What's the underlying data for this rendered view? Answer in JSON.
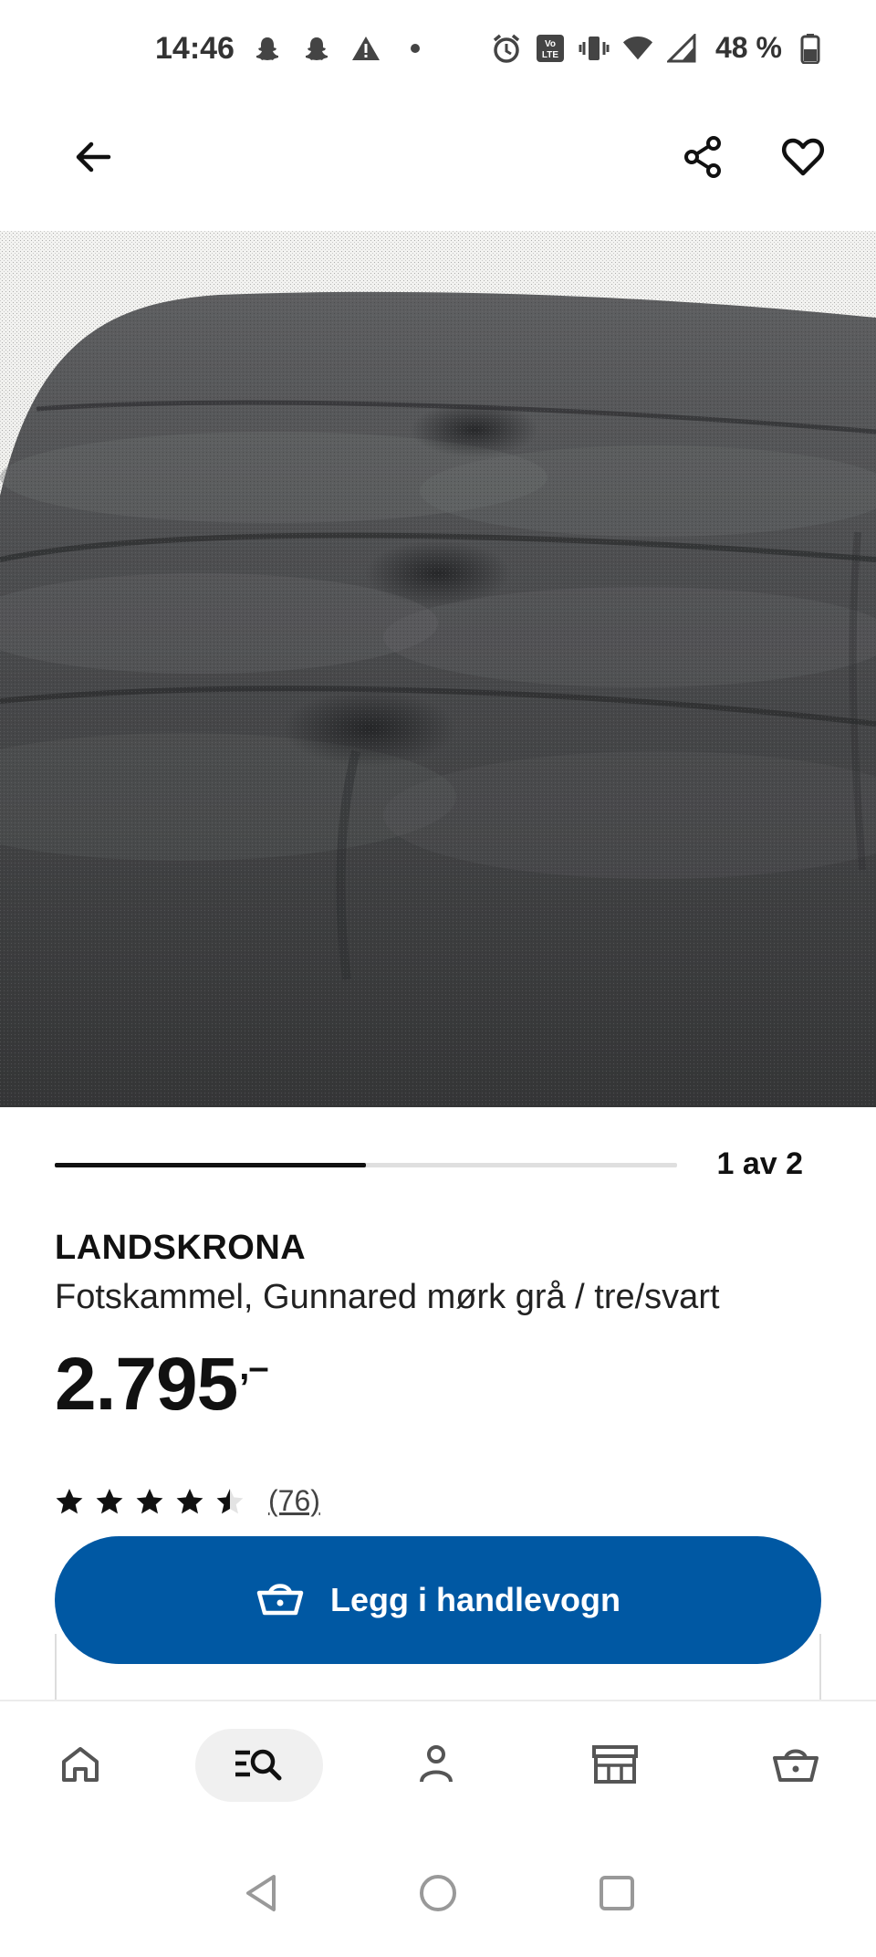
{
  "status_bar": {
    "time": "14:46",
    "battery": "48 %",
    "icons_left": [
      "snapchat-icon",
      "snapchat-icon",
      "warning-icon",
      "dot-icon"
    ],
    "icons_right": [
      "alarm-icon",
      "volte-icon",
      "vibrate-icon",
      "wifi-icon",
      "signal-icon",
      "battery-icon"
    ]
  },
  "header": {
    "back_icon": "arrow-left-icon",
    "share_icon": "share-icon",
    "favorite_icon": "heart-icon"
  },
  "carousel": {
    "counter": "1 av 2",
    "progress": 0.5
  },
  "product": {
    "name": "LANDSKRONA",
    "description": "Fotskammel, Gunnared mørk grå / tre/svart",
    "price": "2.795",
    "price_suffix": ",–",
    "rating": 4.5,
    "review_count": "(76)"
  },
  "cart_button": {
    "label": "Legg i handlevogn",
    "icon": "basket-icon",
    "color": "#0058a3"
  },
  "bottom_nav": {
    "items": [
      {
        "icon": "home-icon",
        "active": false
      },
      {
        "icon": "search-list-icon",
        "active": true
      },
      {
        "icon": "profile-icon",
        "active": false
      },
      {
        "icon": "store-icon",
        "active": false
      },
      {
        "icon": "basket-icon",
        "active": false
      }
    ]
  },
  "system_nav": {
    "items": [
      "back-triangle-icon",
      "home-circle-icon",
      "recents-square-icon"
    ]
  }
}
